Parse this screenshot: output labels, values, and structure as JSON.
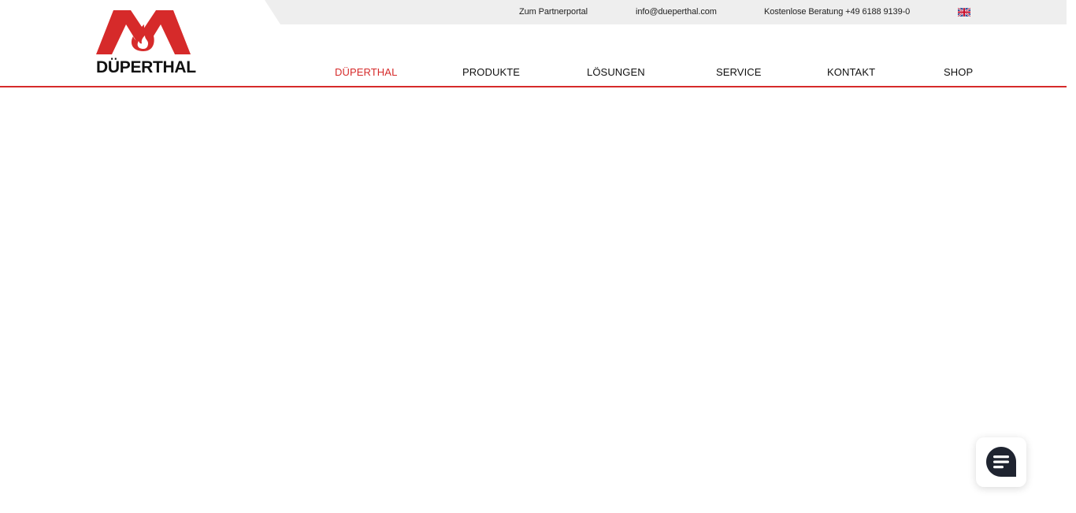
{
  "header": {
    "logo_text": "DÜPERTHAL",
    "top_links": {
      "partner_portal": "Zum Partnerportal",
      "email": "info@dueperthal.com",
      "phone": "Kostenlose Beratung +49 6188 9139-0"
    },
    "language_flag": "uk-flag-icon"
  },
  "nav": {
    "items": [
      {
        "label": "DÜPERTHAL",
        "active": true
      },
      {
        "label": "PRODUKTE",
        "active": false
      },
      {
        "label": "LÖSUNGEN",
        "active": false
      },
      {
        "label": "SERVICE",
        "active": false
      },
      {
        "label": "KONTAKT",
        "active": false
      },
      {
        "label": "SHOP",
        "active": false
      }
    ]
  },
  "chat_widget": {
    "icon": "chat-icon"
  },
  "colors": {
    "brand_red": "#d62a2a",
    "topbar_bg": "#eeeeee",
    "chat_icon": "#1f2430"
  }
}
